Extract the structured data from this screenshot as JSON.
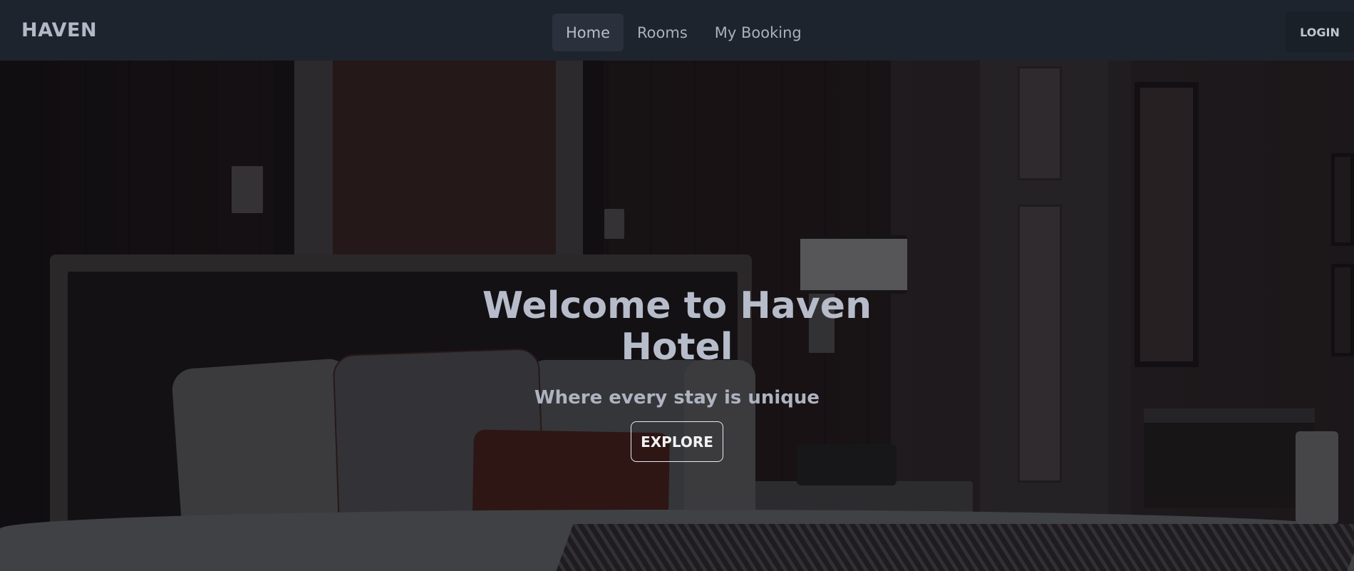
{
  "navbar": {
    "brand": "HAVEN",
    "links": [
      {
        "label": "Home",
        "active": true
      },
      {
        "label": "Rooms",
        "active": false
      },
      {
        "label": "My Booking",
        "active": false
      }
    ],
    "login_label": "LOGIN"
  },
  "hero": {
    "title": "Welcome to Haven Hotel",
    "subtitle": "Where every stay is unique",
    "cta_label": "EXPLORE"
  },
  "colors": {
    "navbar_bg": "#1e242d",
    "active_link_bg": "#2a313c",
    "text_muted": "#a9b0bd"
  }
}
